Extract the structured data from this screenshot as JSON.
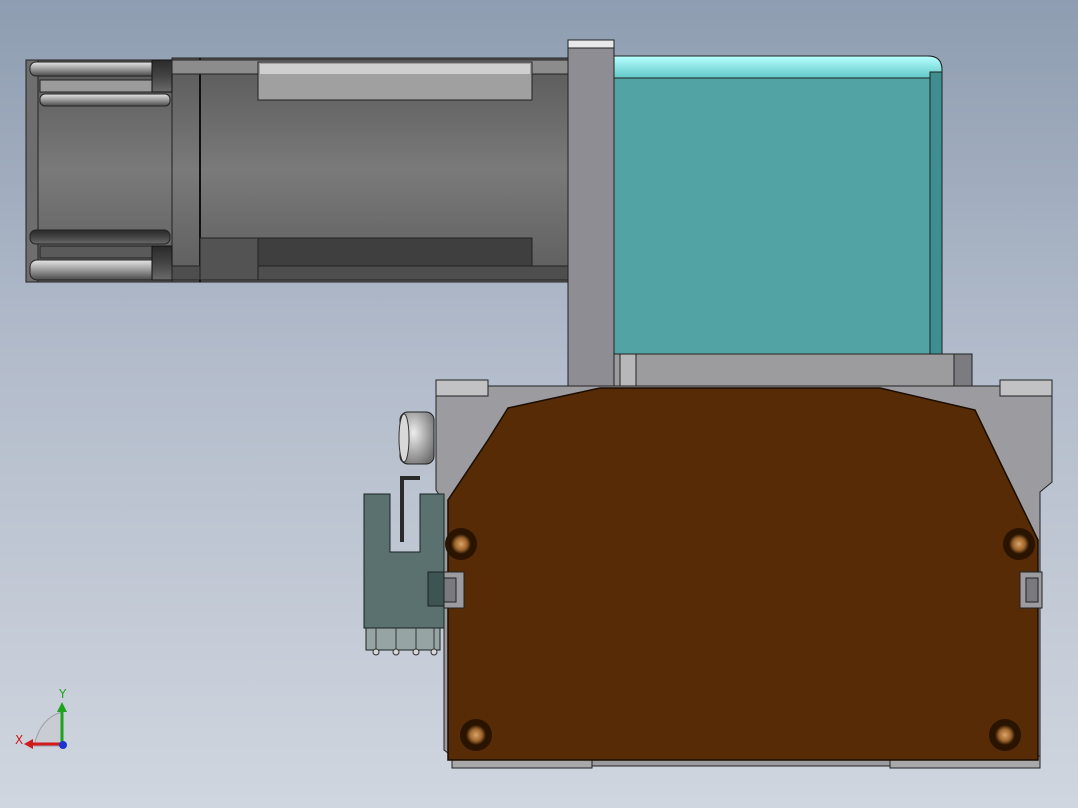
{
  "viewport": {
    "background": [
      "#8e9db1",
      "#b3bccb",
      "#d0d6df"
    ]
  },
  "model": {
    "components": [
      {
        "name": "stepper-motor",
        "color": "#6f6f6f"
      },
      {
        "name": "gearbox",
        "color": "#52a3a3"
      },
      {
        "name": "mounting-plate",
        "color": "#8e8e94"
      },
      {
        "name": "housing-frame",
        "color": "#9d9da1"
      },
      {
        "name": "brown-cover-plate",
        "color": "#562b05"
      },
      {
        "name": "sensor-bracket",
        "color": "#5b7170"
      },
      {
        "name": "limit-roller",
        "color": "#9a9a9a"
      }
    ]
  },
  "triad": {
    "x_label": "X",
    "y_label": "Y",
    "x_color": "#d11a1a",
    "y_color": "#1ea31e",
    "z_color": "#1a33d1"
  }
}
